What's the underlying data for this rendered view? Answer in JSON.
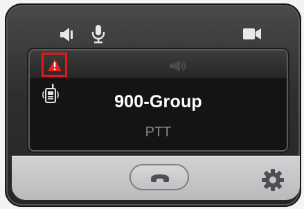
{
  "status_bar": {
    "icons": [
      "speaker-icon",
      "microphone-icon",
      "video-camera-icon"
    ]
  },
  "screen": {
    "alert_icon": "warning-triangle-icon",
    "broadcast_icon": "megaphone-icon",
    "device_icon": "radio-icon",
    "group_name": "900-Group",
    "mode": "PTT"
  },
  "controls": {
    "end_call_icon": "phone-hangup-icon",
    "settings_icon": "gear-icon"
  },
  "colors": {
    "alert_border": "#e3161c",
    "alert_icon": "#e8221e",
    "text_primary": "#ffffff",
    "text_secondary": "#8a8a8a"
  }
}
